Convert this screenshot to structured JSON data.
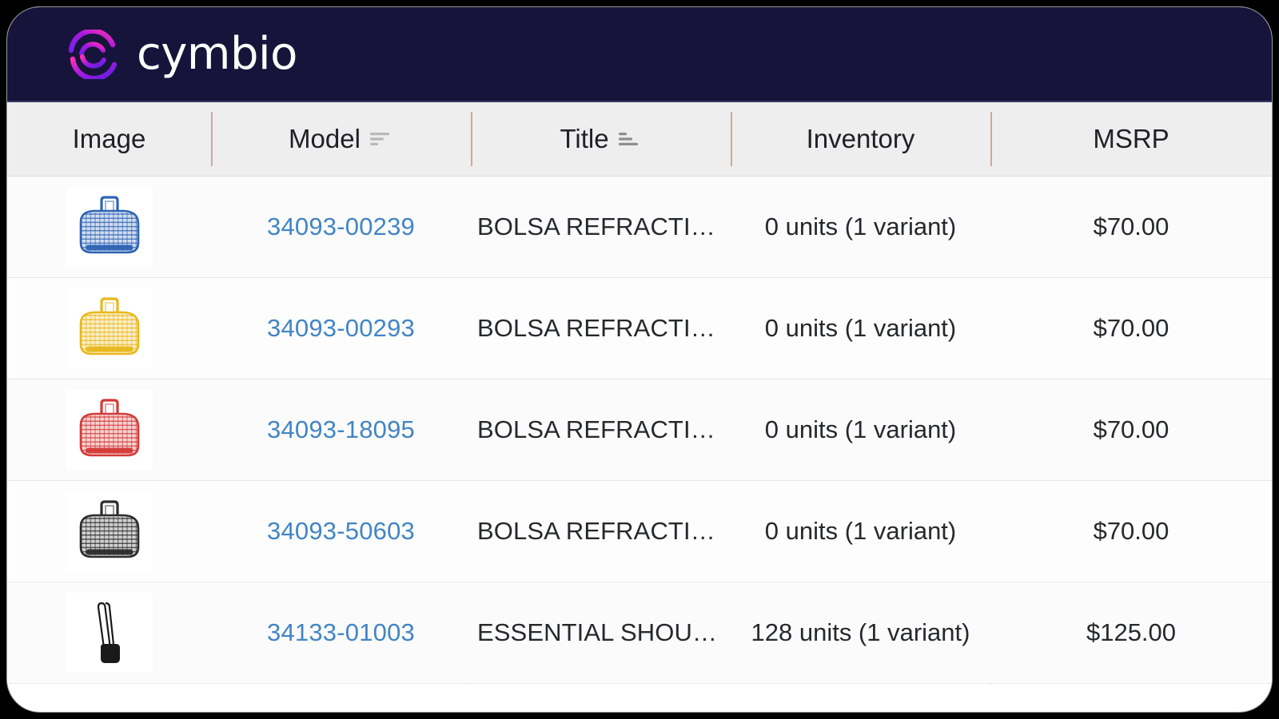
{
  "brand": {
    "name": "cymbio",
    "logo_icon": "cymbio-double-arc-logo",
    "bar_color": "#16143a",
    "logo_gradient_from": "#ff2fb4",
    "logo_gradient_to": "#5b1fe0"
  },
  "table": {
    "columns": [
      {
        "key": "image",
        "label": "Image",
        "sort_icon": null
      },
      {
        "key": "model",
        "label": "Model",
        "sort_icon": "sort-descending-icon"
      },
      {
        "key": "title",
        "label": "Title",
        "sort_icon": "sort-ascending-icon"
      },
      {
        "key": "inventory",
        "label": "Inventory",
        "sort_icon": null
      },
      {
        "key": "msrp",
        "label": "MSRP",
        "sort_icon": null
      }
    ],
    "link_color": "#4285c5",
    "rows": [
      {
        "image_alt": "blue-woven-jelly-duffle-bag",
        "image_color": "#2f63b4",
        "image_kind": "duffle",
        "model": "34093-00239",
        "title": "BOLSA REFRACTION II",
        "inventory": "0 units (1 variant)",
        "msrp": "$70.00"
      },
      {
        "image_alt": "yellow-woven-jelly-duffle-bag",
        "image_color": "#e8b81d",
        "image_kind": "duffle",
        "model": "34093-00293",
        "title": "BOLSA REFRACTION II",
        "inventory": "0 units (1 variant)",
        "msrp": "$70.00"
      },
      {
        "image_alt": "red-woven-jelly-duffle-bag",
        "image_color": "#d33a38",
        "image_kind": "duffle",
        "model": "34093-18095",
        "title": "BOLSA REFRACTION II",
        "inventory": "0 units (1 variant)",
        "msrp": "$70.00"
      },
      {
        "image_alt": "black-woven-jelly-duffle-bag",
        "image_color": "#2c2c2c",
        "image_kind": "duffle",
        "model": "34093-50603",
        "title": "BOLSA REFRACTION II",
        "inventory": "0 units (1 variant)",
        "msrp": "$70.00"
      },
      {
        "image_alt": "black-essential-shoulder-bag",
        "image_color": "#1a1a1a",
        "image_kind": "shoulder",
        "model": "34133-01003",
        "title": "ESSENTIAL SHOULDER...",
        "inventory": "128 units (1 variant)",
        "msrp": "$125.00"
      }
    ]
  }
}
